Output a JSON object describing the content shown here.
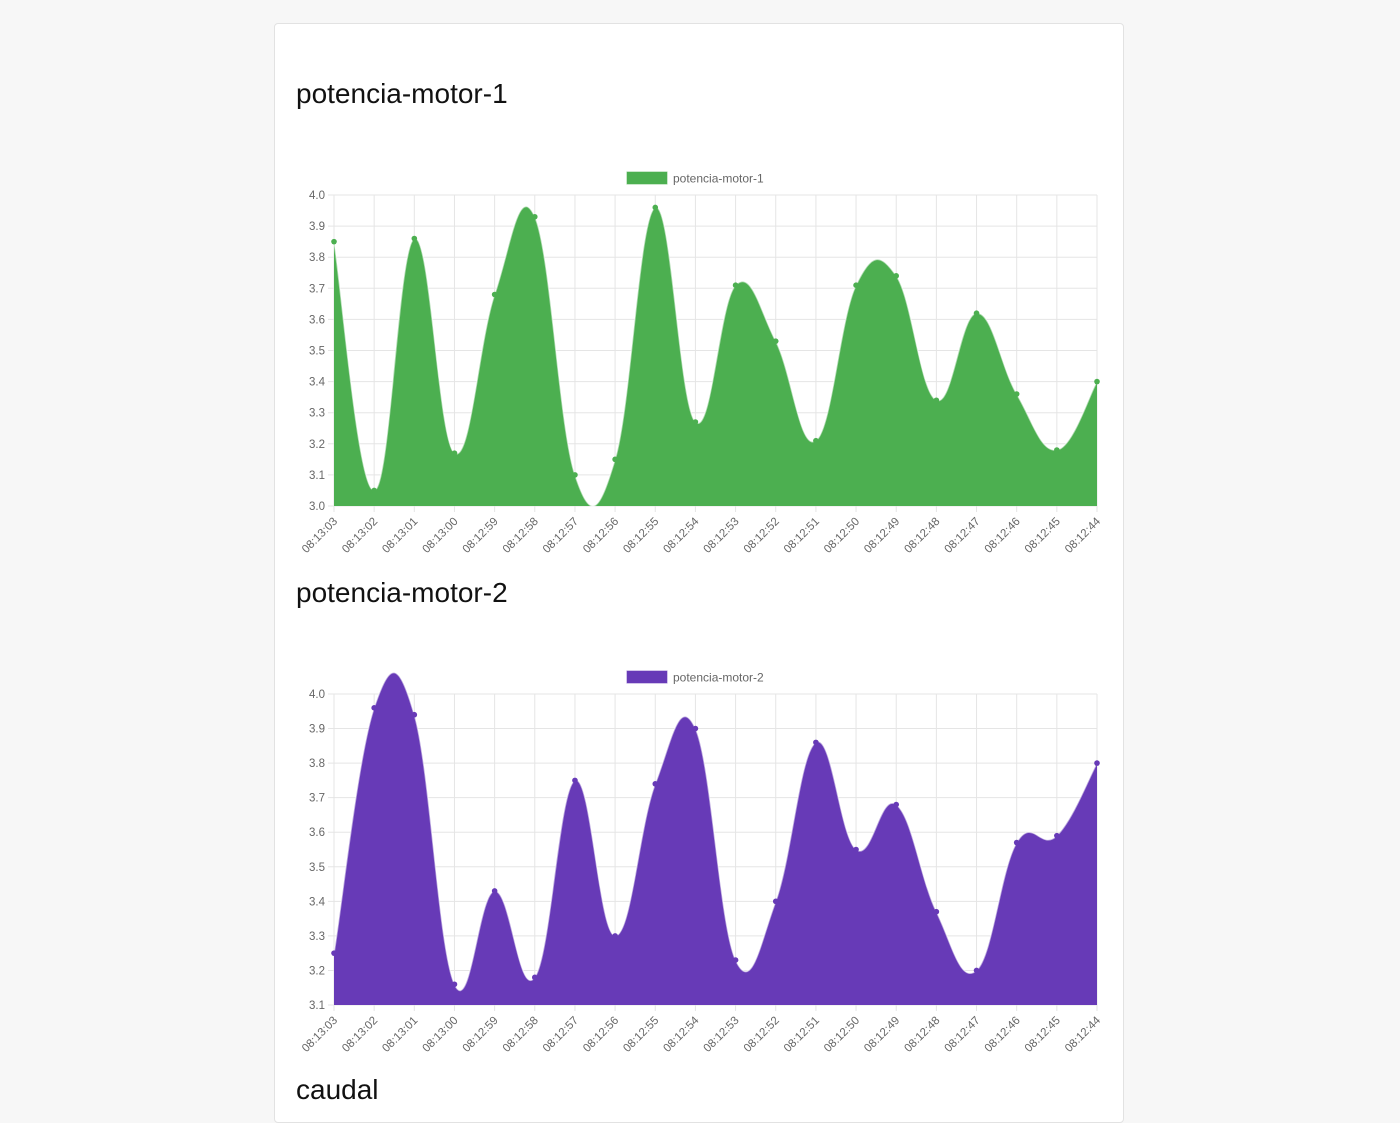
{
  "colors": {
    "series_1": "#4caf50",
    "series_2": "#673ab7",
    "grid": "#e5e5e5",
    "page_background": "#f7f7f7"
  },
  "sections": [
    {
      "heading": "potencia-motor-1",
      "chart_data": {
        "type": "area",
        "title": "",
        "xlabel": "",
        "ylabel": "",
        "ylim": [
          3.0,
          4.0
        ],
        "ytick_step": 0.1,
        "grid": true,
        "legend_position": "top",
        "categories": [
          "08:13:03",
          "08:13:02",
          "08:13:01",
          "08:13:00",
          "08:12:59",
          "08:12:58",
          "08:12:57",
          "08:12:56",
          "08:12:55",
          "08:12:54",
          "08:12:53",
          "08:12:52",
          "08:12:51",
          "08:12:50",
          "08:12:49",
          "08:12:48",
          "08:12:47",
          "08:12:46",
          "08:12:45",
          "08:12:44"
        ],
        "series": [
          {
            "name": "potencia-motor-1",
            "color": "#4caf50",
            "values": [
              3.85,
              3.05,
              3.86,
              3.17,
              3.68,
              3.93,
              3.1,
              3.15,
              3.96,
              3.27,
              3.71,
              3.53,
              3.21,
              3.71,
              3.74,
              3.34,
              3.62,
              3.36,
              3.18,
              3.4
            ]
          }
        ]
      }
    },
    {
      "heading": "potencia-motor-2",
      "chart_data": {
        "type": "area",
        "title": "",
        "xlabel": "",
        "ylabel": "",
        "ylim": [
          3.1,
          4.0
        ],
        "ytick_step": 0.1,
        "grid": true,
        "legend_position": "top",
        "categories": [
          "08:13:03",
          "08:13:02",
          "08:13:01",
          "08:13:00",
          "08:12:59",
          "08:12:58",
          "08:12:57",
          "08:12:56",
          "08:12:55",
          "08:12:54",
          "08:12:53",
          "08:12:52",
          "08:12:51",
          "08:12:50",
          "08:12:49",
          "08:12:48",
          "08:12:47",
          "08:12:46",
          "08:12:45",
          "08:12:44"
        ],
        "series": [
          {
            "name": "potencia-motor-2",
            "color": "#673ab7",
            "values": [
              3.25,
              3.96,
              3.94,
              3.16,
              3.43,
              3.18,
              3.75,
              3.3,
              3.74,
              3.9,
              3.23,
              3.4,
              3.86,
              3.55,
              3.68,
              3.37,
              3.2,
              3.57,
              3.59,
              3.8
            ]
          }
        ]
      }
    },
    {
      "heading": "caudal"
    }
  ]
}
